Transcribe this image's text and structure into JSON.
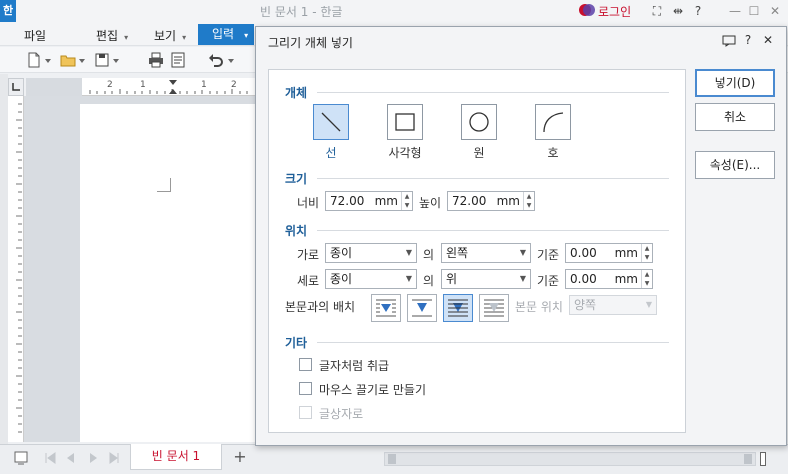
{
  "window": {
    "app_logo": "한",
    "title": "빈 문서 1 - 한글",
    "login_label": "로그인",
    "buttons": {
      "fullscreen": "⛶",
      "split": "⇹",
      "help": "?",
      "minimize": "—",
      "maximize": "☐",
      "close": "✕"
    }
  },
  "menu": {
    "items": [
      {
        "label": "파일",
        "has_arrow": false
      },
      {
        "label": "편집",
        "has_arrow": true
      },
      {
        "label": "보기",
        "has_arrow": true
      },
      {
        "label": "입력",
        "has_arrow": true,
        "active": true
      }
    ],
    "arrow": "▾"
  },
  "ruler": {
    "ticks": [
      "2",
      "1",
      "1",
      "2"
    ]
  },
  "bottom": {
    "doc_tab": "빈 문서 1",
    "add_tab": "+"
  },
  "dialog": {
    "title": "그리기 개체 넣기",
    "help": "?",
    "close": "✕",
    "sections": {
      "object": "개체",
      "size": "크기",
      "position": "위치",
      "etc": "기타"
    },
    "shapes": [
      {
        "label": "선",
        "icon": "line-icon",
        "selected": true
      },
      {
        "label": "사각형",
        "icon": "rectangle-icon",
        "selected": false
      },
      {
        "label": "원",
        "icon": "ellipse-icon",
        "selected": false
      },
      {
        "label": "호",
        "icon": "arc-icon",
        "selected": false
      }
    ],
    "size": {
      "width_label": "너비",
      "width_value": "72.00",
      "height_label": "높이",
      "height_value": "72.00",
      "unit": "mm"
    },
    "position": {
      "horizontal_label": "가로",
      "horizontal_ref": "종이",
      "horizontal_of": "의",
      "horizontal_align": "왼쪽",
      "horizontal_base_label": "기준",
      "horizontal_offset": "0.00",
      "vertical_label": "세로",
      "vertical_ref": "종이",
      "vertical_of": "의",
      "vertical_align": "위",
      "vertical_base_label": "기준",
      "vertical_offset": "0.00",
      "unit": "mm",
      "wrap_label": "본문과의 배치",
      "wrap_modes": [
        "square-wrap-icon",
        "tight-wrap-icon",
        "behind-text-icon",
        "in-front-of-text-icon"
      ],
      "wrap_selected": 2,
      "text_position_label": "본문 위치",
      "text_position_value": "양쪽"
    },
    "etc": {
      "treat_as_char": {
        "label": "글자처럼 취급",
        "checked": false,
        "disabled": false
      },
      "mouse_drag": {
        "label": "마우스 끌기로 만들기",
        "checked": false,
        "disabled": false
      },
      "glyph_box": {
        "label": "글상자로",
        "checked": false,
        "disabled": true
      }
    },
    "buttons": {
      "insert": "넣기(D)",
      "cancel": "취소",
      "properties": "속성(E)..."
    }
  }
}
